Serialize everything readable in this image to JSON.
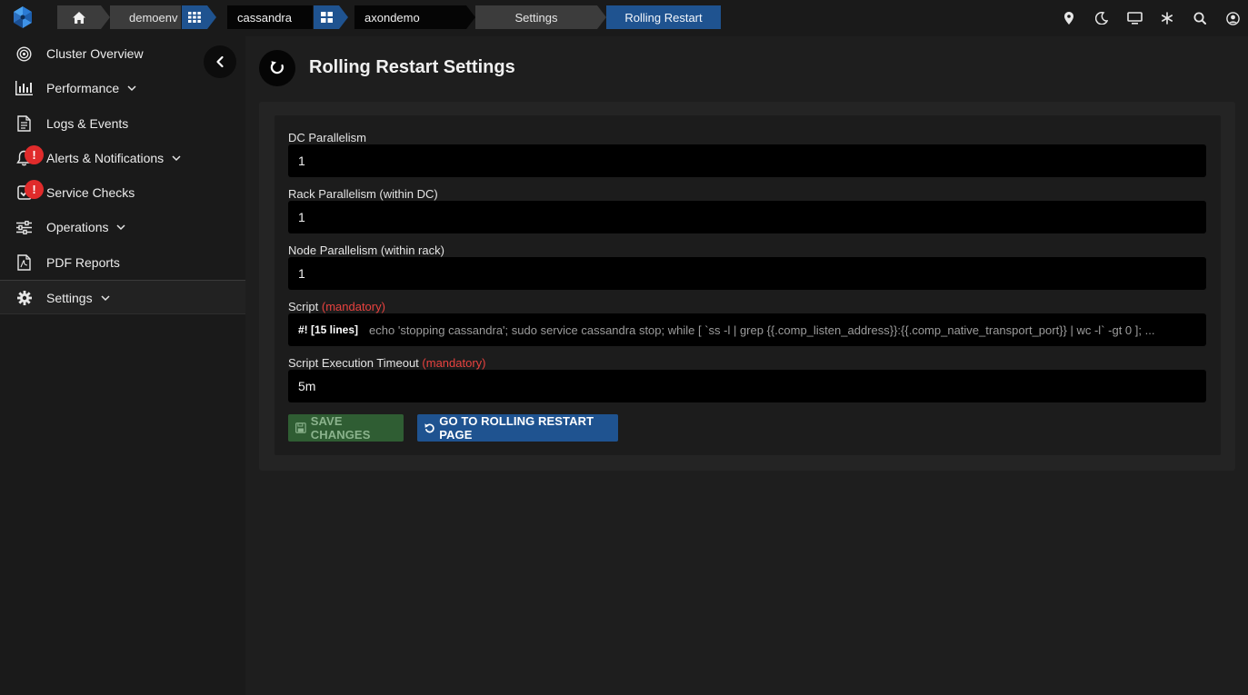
{
  "topbar": {
    "breadcrumbs": {
      "environment": "demoenv",
      "cluster_type": "cassandra",
      "cluster": "axondemo",
      "section": "Settings",
      "current": "Rolling Restart"
    },
    "icons": [
      "location-pin-icon",
      "moon-icon",
      "monitor-icon",
      "snowflake-icon",
      "search-icon",
      "user-icon"
    ]
  },
  "sidebar": {
    "items": [
      {
        "label": "Cluster Overview",
        "icon": "target-icon"
      },
      {
        "label": "Performance",
        "icon": "bar-chart-icon"
      },
      {
        "label": "Logs & Events",
        "icon": "document-icon"
      },
      {
        "label": "Alerts & Notifications",
        "icon": "bell-icon",
        "badge": "!"
      },
      {
        "label": "Service Checks",
        "icon": "checkbox-icon",
        "badge": "!"
      },
      {
        "label": "Operations",
        "icon": "sliders-icon"
      },
      {
        "label": "PDF Reports",
        "icon": "pdf-icon"
      },
      {
        "label": "Settings",
        "icon": "gear-icon"
      }
    ]
  },
  "page": {
    "title": "Rolling Restart Settings"
  },
  "form": {
    "dc_parallelism": {
      "label": "DC Parallelism",
      "value": "1"
    },
    "rack_parallelism": {
      "label": "Rack Parallelism (within DC)",
      "value": "1"
    },
    "node_parallelism": {
      "label": "Node Parallelism (within rack)",
      "value": "1"
    },
    "script": {
      "label": "Script",
      "required": "(mandatory)",
      "shebang": "#! [15 lines]",
      "preview": "echo 'stopping cassandra'; sudo service cassandra stop; while [ `ss -l | grep {{.comp_listen_address}}:{{.comp_native_transport_port}} | wc -l` -gt 0 ]; ..."
    },
    "timeout": {
      "label": "Script Execution Timeout",
      "required": "(mandatory)",
      "value": "5m"
    }
  },
  "buttons": {
    "save": "SAVE CHANGES",
    "go": "GO TO ROLLING RESTART PAGE"
  },
  "colors": {
    "accent_blue": "#1f5390",
    "save_green": "#2f5d33",
    "required_red": "#e8423f",
    "badge_red": "#e02b2b"
  }
}
